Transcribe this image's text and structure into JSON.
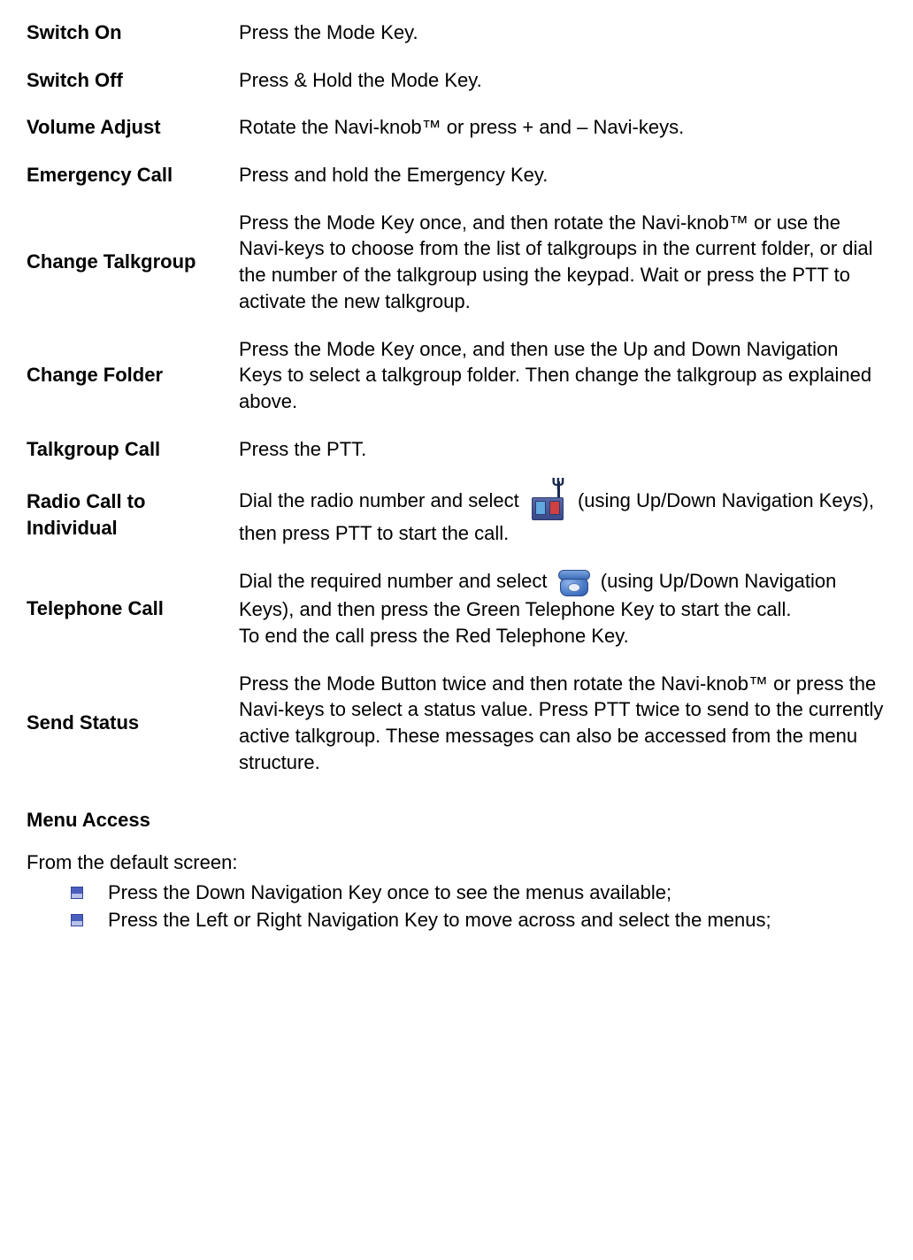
{
  "rows": [
    {
      "label": "Switch On",
      "desc": "Press the Mode Key."
    },
    {
      "label": "Switch Off",
      "desc": "Press & Hold the Mode Key."
    },
    {
      "label": "Volume Adjust",
      "desc": "Rotate the Navi-knob™ or press + and – Navi-keys."
    },
    {
      "label": "Emergency Call",
      "desc": "Press and hold the Emergency Key."
    },
    {
      "label": "Change Talkgroup",
      "desc": "Press the Mode Key once, and then rotate the Navi-knob™ or use the Navi-keys to choose from the list of talkgroups in the current folder, or dial the number of the talkgroup using the keypad. Wait or press the PTT to activate the new talkgroup."
    },
    {
      "label": "Change Folder",
      "desc": "Press the Mode Key once, and then use the Up and Down Navigation Keys to select a talkgroup folder. Then change the talkgroup as explained above."
    },
    {
      "label": "Talkgroup Call",
      "desc": "Press the PTT."
    }
  ],
  "radio_call": {
    "label": "Radio Call to Individual",
    "desc_before": "Dial the radio number and select ",
    "desc_after": " (using Up/Down Navigation Keys), then press PTT to start the call."
  },
  "telephone_call": {
    "label": "Telephone Call",
    "desc_before": "Dial the required number and select ",
    "desc_mid": " (using Up/Down Navigation Keys), and then press the Green Telephone Key to start the call.",
    "desc_after": "To end the call press the Red Telephone Key."
  },
  "send_status": {
    "label": "Send Status",
    "desc": "Press the Mode Button twice and then rotate the Navi-knob™ or press the Navi-keys to select a status value. Press PTT twice to send to the currently active talkgroup. These messages can also be accessed from the menu structure."
  },
  "menu_access": {
    "heading": "Menu Access",
    "intro": "From the default screen:",
    "bullets": [
      "Press the Down Navigation Key once to see the menus available;",
      "Press the Left or Right Navigation Key to move across and select the menus;"
    ]
  }
}
